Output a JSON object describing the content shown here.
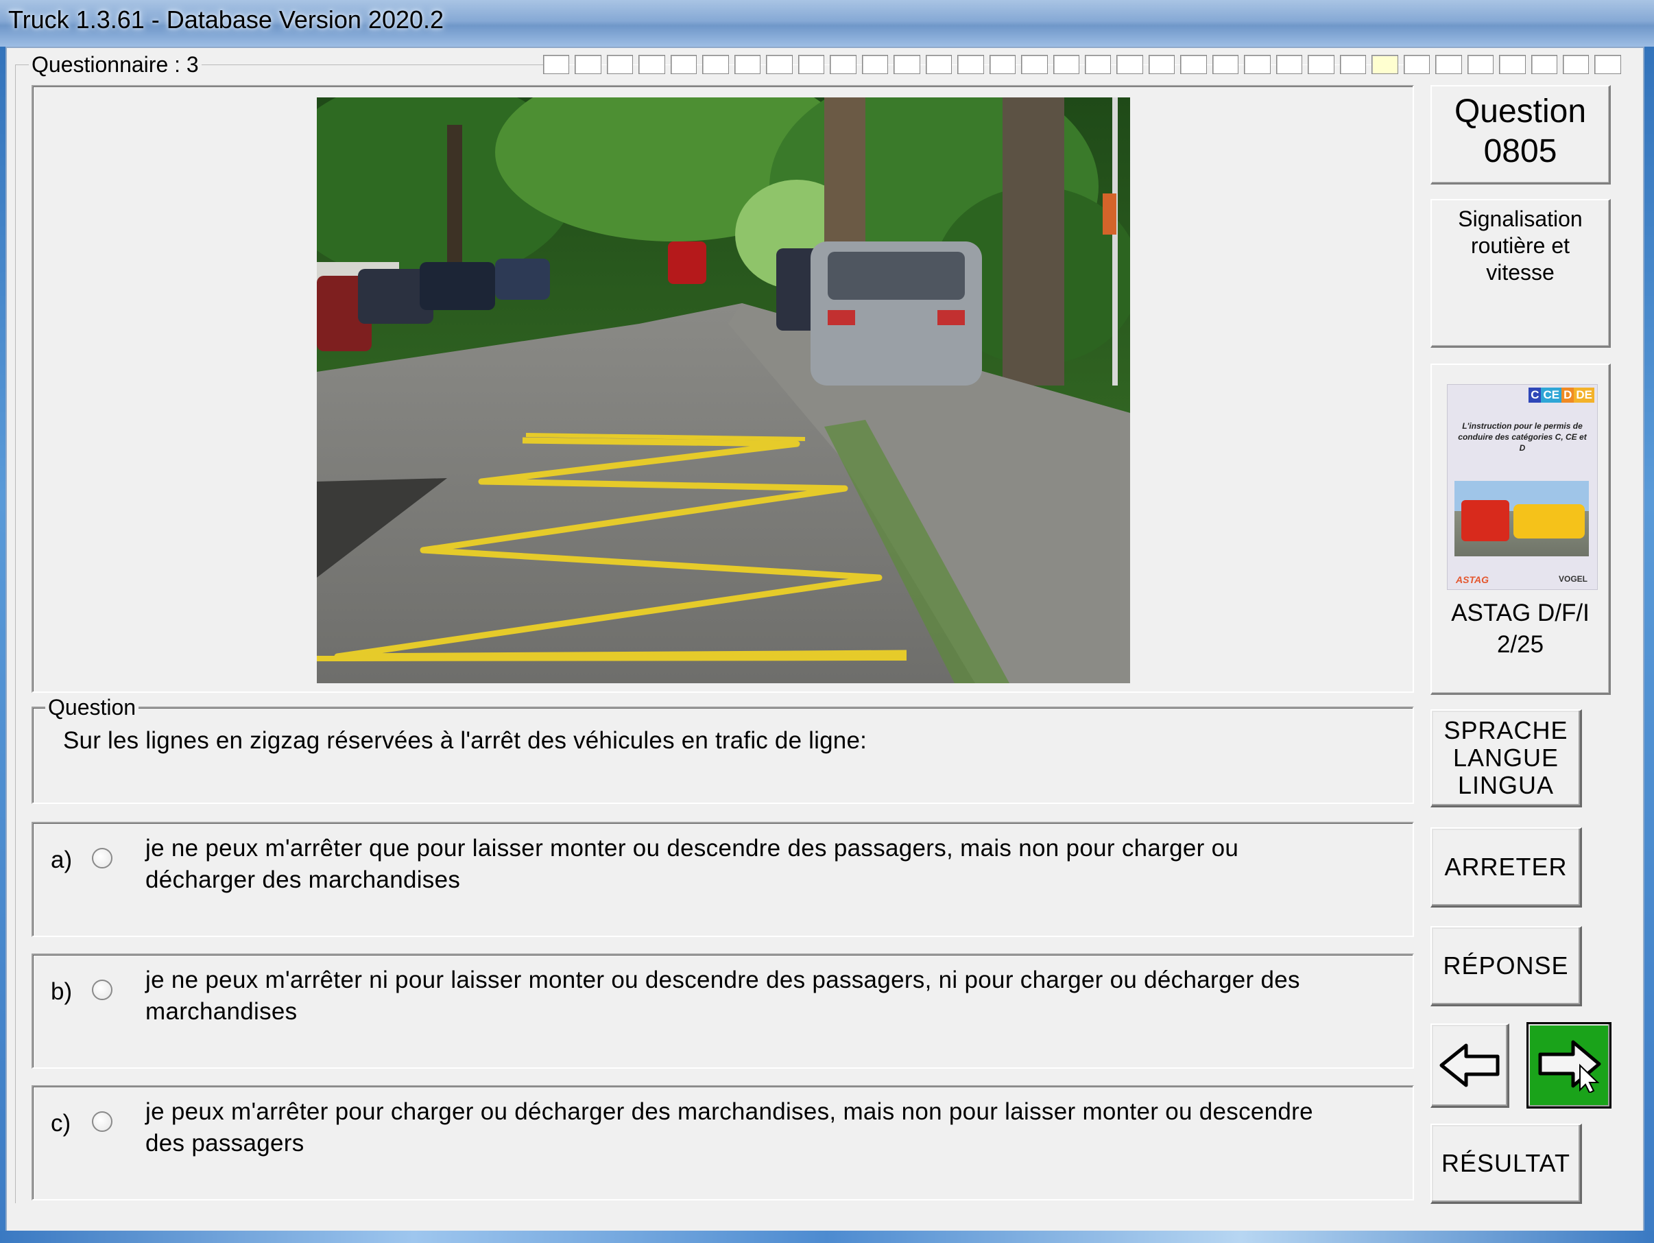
{
  "window": {
    "title": "Truck 1.3.61 - Database Version 2020.2"
  },
  "questionnaire": {
    "label": "Questionnaire : 3",
    "progress_total": 34,
    "progress_current": 27
  },
  "question_panel": {
    "number_label": "Question",
    "number": "0805",
    "category": "Signalisation routière et vitesse",
    "book": {
      "source": "ASTAG D/F/I",
      "page": "2/25",
      "cover_badges": [
        "C",
        "CE",
        "D",
        "DE"
      ],
      "cover_text": "L'instruction pour le permis de conduire des catégories C, CE et D",
      "cover_logos": [
        "ASTAG",
        "VOGEL"
      ]
    }
  },
  "question": {
    "legend": "Question",
    "text": "Sur les lignes en zigzag réservées à l'arrêt des véhicules en trafic de ligne:"
  },
  "answers": [
    {
      "letter": "a)",
      "line1": "je ne peux m'arrêter que pour laisser monter ou descendre des passagers, mais non pour charger ou",
      "line2": "décharger des marchandises"
    },
    {
      "letter": "b)",
      "line1": "je ne peux m'arrêter ni pour laisser monter ou descendre des passagers, ni pour charger ou décharger des",
      "line2": "marchandises"
    },
    {
      "letter": "c)",
      "line1": "je peux m'arrêter pour charger ou décharger des marchandises, mais non pour laisser monter ou descendre",
      "line2": "des passagers"
    }
  ],
  "buttons": {
    "language": [
      "SPRACHE",
      "LANGUE",
      "LINGUA"
    ],
    "stop": "ARRETER",
    "answer": "RÉPONSE",
    "result": "RÉSULTAT"
  },
  "icons": {
    "prev": "arrow-left-icon",
    "next": "arrow-right-icon",
    "next_bg": "#1aa31a"
  }
}
